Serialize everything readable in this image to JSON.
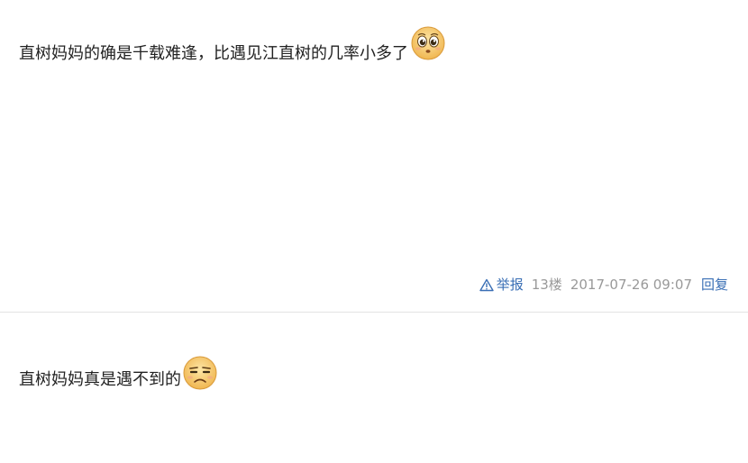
{
  "posts": [
    {
      "text": "直树妈妈的确是千载难逢，比遇见江直树的几率小多了",
      "emoji": "tearful-pleading-emoji",
      "meta": {
        "report_label": "举报",
        "floor": "13楼",
        "timestamp": "2017-07-26 09:07",
        "reply_label": "回复"
      }
    },
    {
      "text": "直树妈妈真是遇不到的",
      "emoji": "unamused-frown-emoji"
    }
  ],
  "colors": {
    "link": "#3a6fb5",
    "meta_gray": "#999999",
    "divider": "#e4e4e4",
    "emoji_face": "#f7c86a"
  }
}
